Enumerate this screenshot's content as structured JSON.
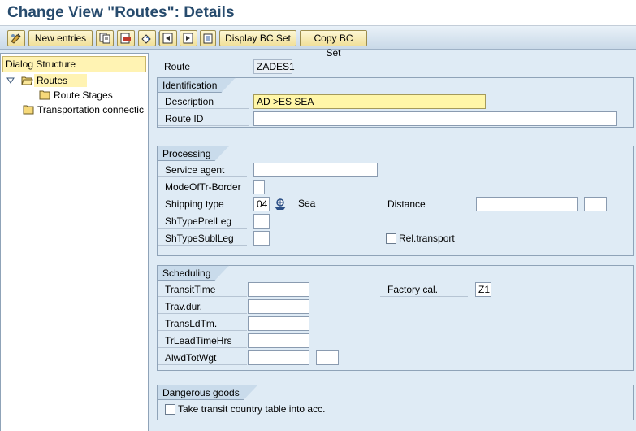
{
  "title": "Change View \"Routes\": Details",
  "toolbar": {
    "new_entries": "New entries",
    "display_bc_set": "Display BC Set",
    "copy_bc_set": "Copy BC Set",
    "icons": [
      "edit-toggle-icon",
      "copy-icon",
      "delete-icon",
      "undo-icon",
      "previous-entry-icon",
      "next-entry-icon",
      "print-icon"
    ]
  },
  "dialog_structure": {
    "header": "Dialog Structure",
    "items": [
      {
        "label": "Routes",
        "selected": true
      },
      {
        "label": "Route Stages"
      },
      {
        "label": "Transportation connectic"
      }
    ]
  },
  "route": {
    "label": "Route",
    "value": "ZADES1"
  },
  "identification": {
    "title": "Identification",
    "description_label": "Description",
    "description_value": "AD >ES  SEA",
    "route_id_label": "Route ID",
    "route_id_value": ""
  },
  "processing": {
    "title": "Processing",
    "service_agent_label": "Service agent",
    "service_agent_value": "",
    "mode_label": "ModeOfTr-Border",
    "mode_value": "",
    "shipping_type_label": "Shipping type",
    "shipping_type_value": "04",
    "shipping_type_text": "Sea",
    "distance_label": "Distance",
    "distance_value": "",
    "distance_unit": "",
    "prel_label": "ShTypePrelLeg",
    "prel_value": "",
    "subl_label": "ShTypeSublLeg",
    "subl_value": "",
    "rel_transport_label": "Rel.transport",
    "rel_transport_checked": false
  },
  "scheduling": {
    "title": "Scheduling",
    "transit_time_label": "TransitTime",
    "trav_dur_label": "Trav.dur.",
    "trans_ld_label": "TransLdTm.",
    "tr_lead_label": "TrLeadTimeHrs",
    "alwd_label": "AlwdTotWgt",
    "factory_cal_label": "Factory cal.",
    "factory_cal_value": "Z1"
  },
  "dangerous_goods": {
    "title": "Dangerous goods",
    "transit_table_label": "Take transit country table into acc.",
    "transit_table_checked": false
  },
  "colors": {
    "background": "#dfebf5",
    "title": "#274b6d",
    "button": "#f1e09a",
    "required_field": "#fff6a8",
    "selection": "#fff3b3"
  }
}
